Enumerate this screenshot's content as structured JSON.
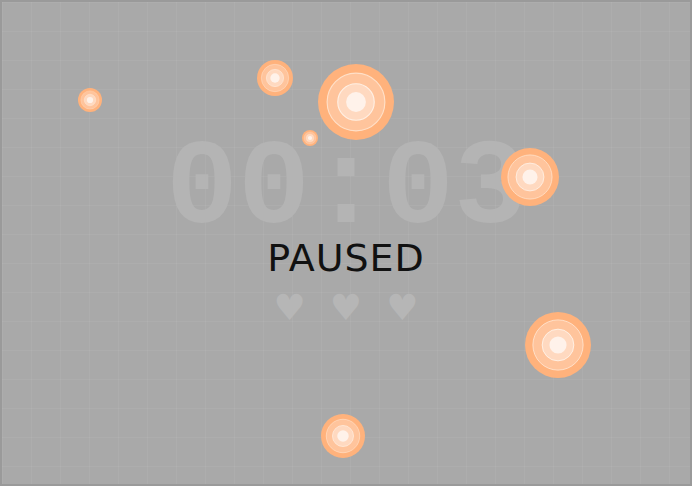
{
  "game": {
    "paused": true,
    "overlay_text": "PAUSED"
  },
  "timer": "00:03",
  "lives": [
    {
      "icon": "♥",
      "filled": true
    },
    {
      "icon": "♥",
      "filled": true
    },
    {
      "icon": "♥",
      "filled": true
    }
  ],
  "targets": [
    {
      "active": true
    },
    {
      "active": true
    },
    {
      "active": true
    },
    {
      "active": true
    },
    {
      "active": true
    },
    {
      "active": true
    },
    {
      "active": true
    }
  ]
}
